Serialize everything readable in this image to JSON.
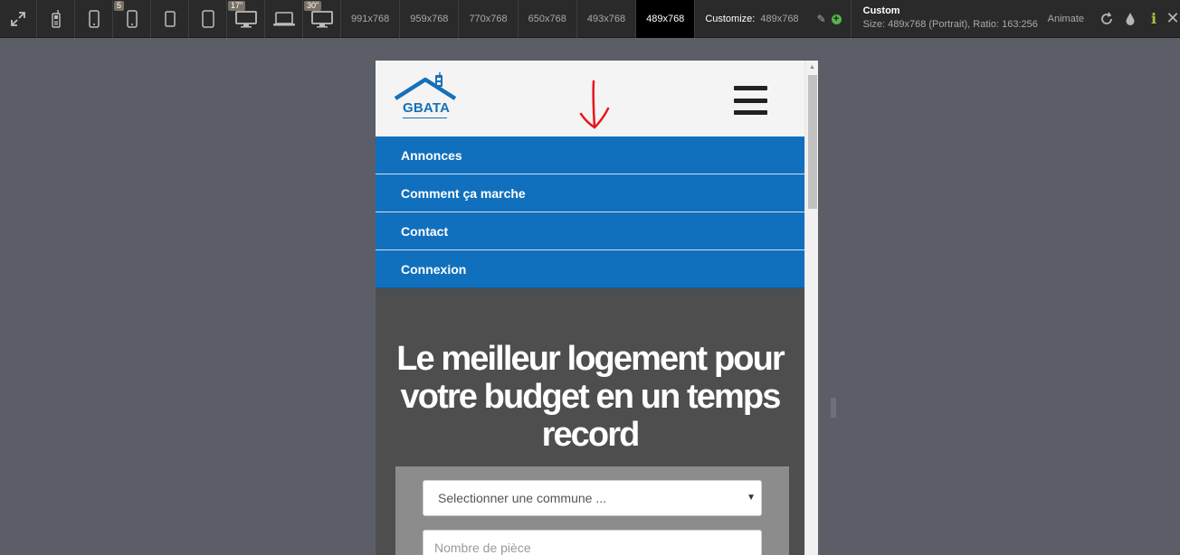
{
  "toolbar": {
    "icons": [
      {
        "name": "fullscreen-icon"
      },
      {
        "name": "feature-phone-icon"
      },
      {
        "name": "phone-icon"
      },
      {
        "name": "phone-5-icon",
        "badge": "5"
      },
      {
        "name": "small-tablet-icon"
      },
      {
        "name": "tablet-icon"
      },
      {
        "name": "monitor-17-icon",
        "badge": "17\""
      },
      {
        "name": "laptop-icon"
      },
      {
        "name": "monitor-30-icon",
        "badge": "30\""
      }
    ],
    "resolutions": [
      "991x768",
      "959x768",
      "770x768",
      "650x768",
      "493x768",
      "489x768"
    ],
    "active_resolution": "489x768",
    "customize_label": "Customize:",
    "customize_value": "489x768",
    "info_title": "Custom",
    "info_detail": "Size: 489x768 (Portrait), Ratio: 163:256",
    "animate_label": "Animate",
    "right_icons": [
      "rotate-icon",
      "drop-icon",
      "info-icon",
      "close-icon"
    ]
  },
  "site": {
    "logo_text": "GBATA",
    "menu": [
      "Annonces",
      "Comment ça marche",
      "Contact",
      "Connexion"
    ],
    "hero_title": "Le meilleur logement pour votre budget en un temps record",
    "commune_select": "Selectionner une commune ...",
    "rooms_placeholder": "Nombre de pièce"
  },
  "colors": {
    "brand_blue": "#1170bd",
    "hero_bg": "#4e4e4e",
    "toolbar_bg": "#2a2a2a",
    "workspace_bg": "#5b5e66"
  }
}
